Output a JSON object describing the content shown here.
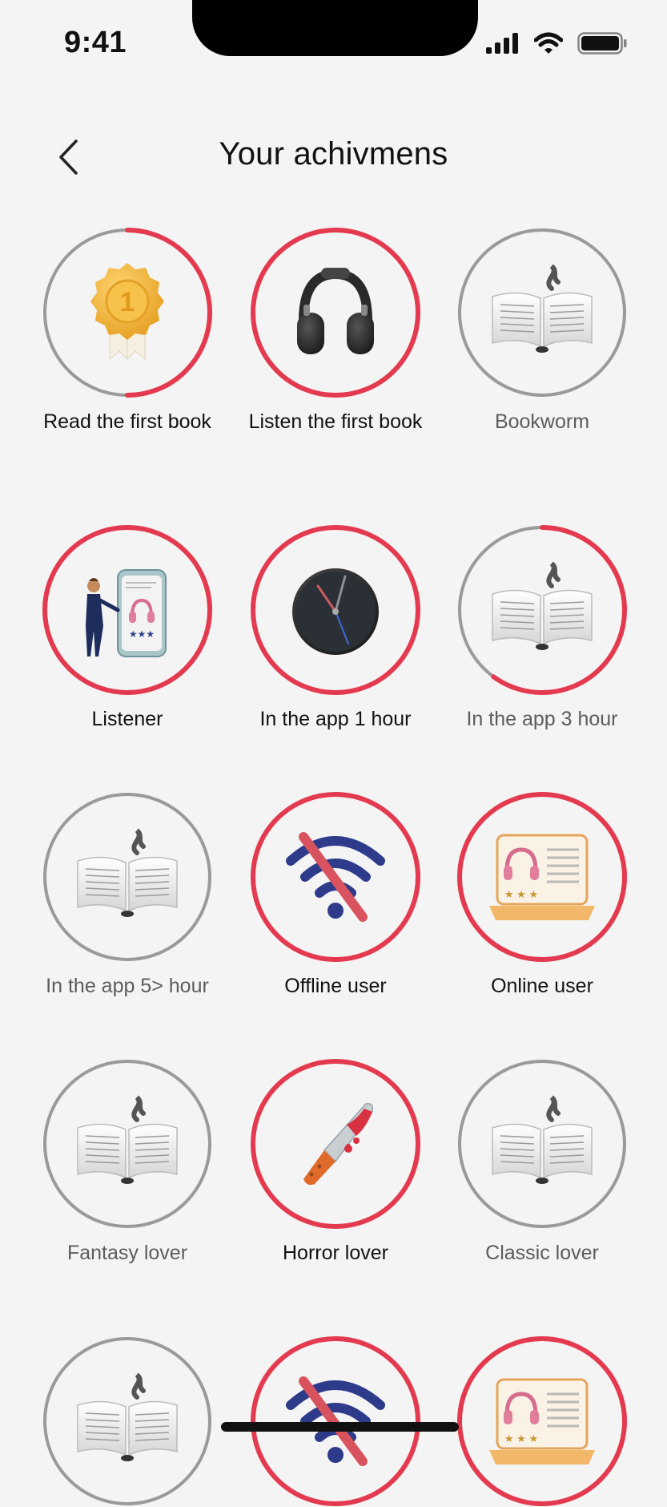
{
  "status": {
    "time": "9:41"
  },
  "header": {
    "title": "Your achivmens"
  },
  "colors": {
    "accent": "#e43a4f",
    "inactive_ring": "#9a9a9a",
    "background": "#f4f4f4"
  },
  "achievements": [
    {
      "label": "Read the first book",
      "icon": "medal-icon",
      "progress": 0.5,
      "unlocked": true
    },
    {
      "label": "Listen the first book",
      "icon": "headphones-icon",
      "progress": 1.0,
      "unlocked": true
    },
    {
      "label": "Bookworm",
      "icon": "open-book-icon",
      "progress": 0,
      "unlocked": false
    },
    {
      "label": "Listener",
      "icon": "phone-listener-icon",
      "progress": 1.0,
      "unlocked": true
    },
    {
      "label": "In the app 1 hour",
      "icon": "clock-icon",
      "progress": 1.0,
      "unlocked": true
    },
    {
      "label": "In the app 3 hour",
      "icon": "open-book-icon",
      "progress": 0.6,
      "unlocked": false
    },
    {
      "label": "In the app 5> hour",
      "icon": "open-book-icon",
      "progress": 0,
      "unlocked": false
    },
    {
      "label": "Offline user",
      "icon": "no-wifi-icon",
      "progress": 1.0,
      "unlocked": true
    },
    {
      "label": "Online user",
      "icon": "laptop-headphones-icon",
      "progress": 1.0,
      "unlocked": true
    },
    {
      "label": "Fantasy lover",
      "icon": "open-book-icon",
      "progress": 0,
      "unlocked": false
    },
    {
      "label": "Horror lover",
      "icon": "knife-icon",
      "progress": 1.0,
      "unlocked": true
    },
    {
      "label": "Classic lover",
      "icon": "open-book-icon",
      "progress": 0,
      "unlocked": false
    },
    {
      "label": "",
      "icon": "open-book-icon",
      "progress": 0,
      "unlocked": false
    },
    {
      "label": "",
      "icon": "no-wifi-icon",
      "progress": 1.0,
      "unlocked": true
    },
    {
      "label": "",
      "icon": "laptop-headphones-icon",
      "progress": 1.0,
      "unlocked": true
    }
  ]
}
